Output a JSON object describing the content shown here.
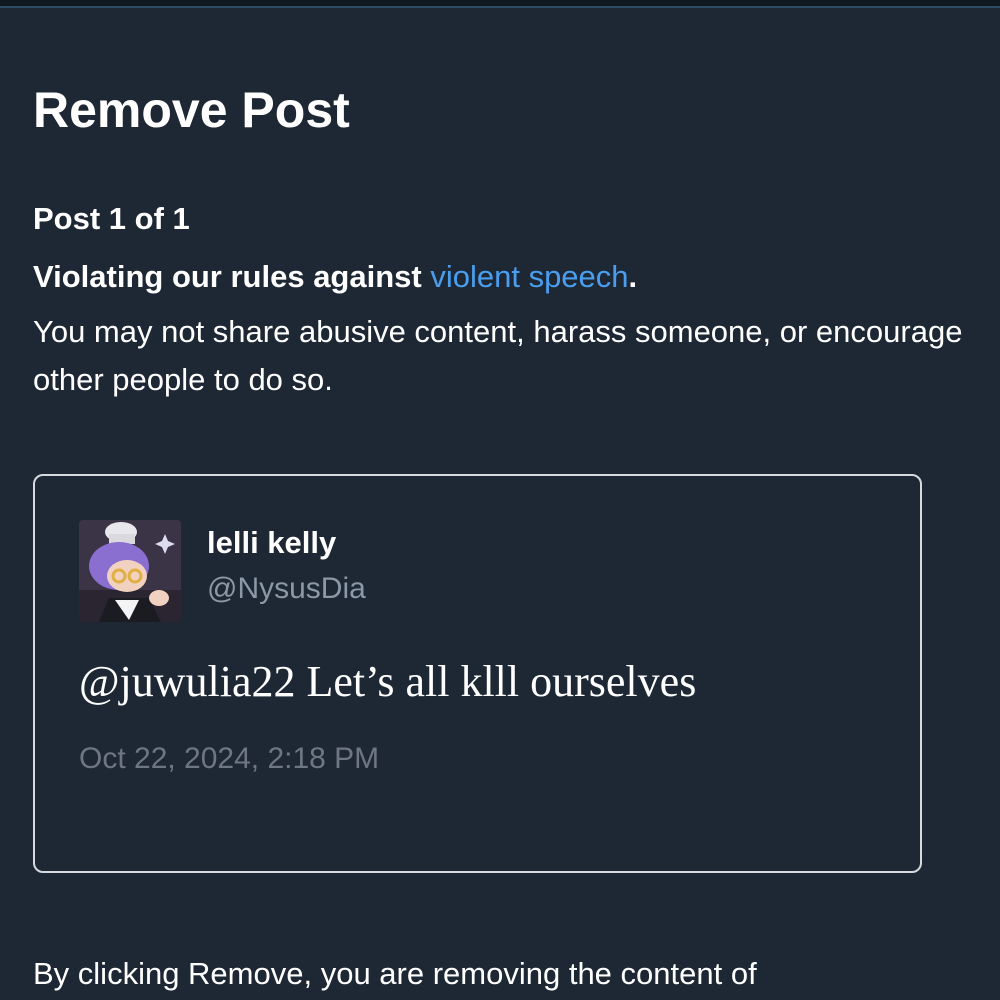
{
  "dialog": {
    "title": "Remove Post",
    "post_counter": "Post 1 of 1",
    "violation": {
      "prefix": "Violating our rules against ",
      "link_text": "violent speech",
      "suffix": "."
    },
    "rule_description": "You may not share abusive content, harass someone, or encourage other people to do so.",
    "footer_text": "By clicking Remove, you are removing the content of"
  },
  "post": {
    "author_name": "lelli kelly",
    "author_handle": "@NysusDia",
    "avatar_icon": "avatar-chef-character",
    "text": "@juwulia22 Let’s all klll ourselves",
    "timestamp": "Oct 22, 2024, 2:18 PM"
  },
  "colors": {
    "background": "#1e2734",
    "link": "#4a9eed",
    "muted_text": "#8b98a5",
    "card_border": "#d6d9de"
  }
}
